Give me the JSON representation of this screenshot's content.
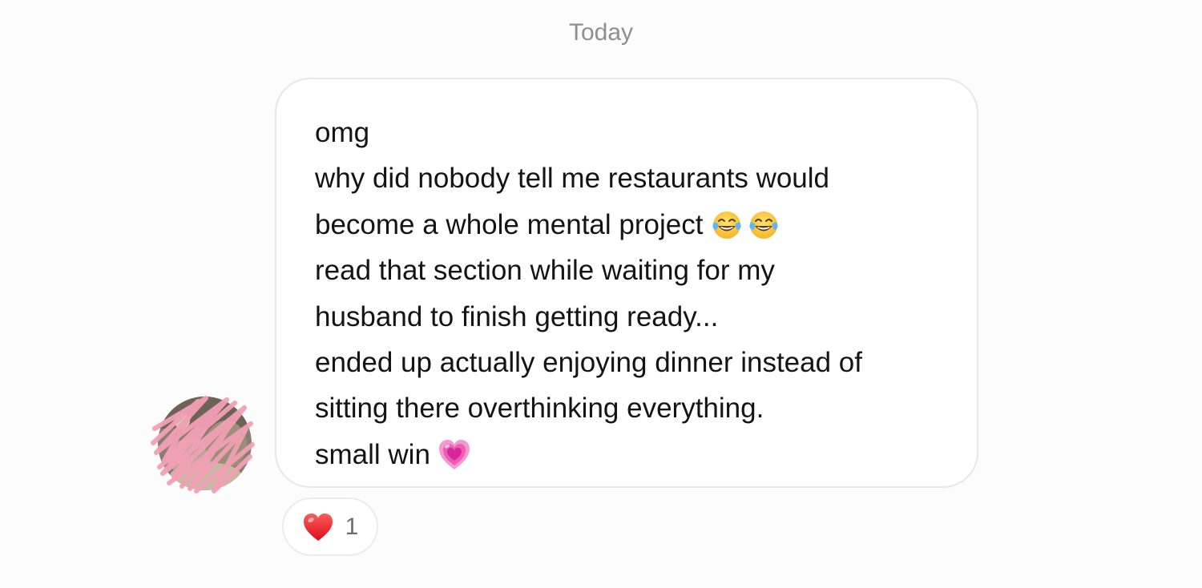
{
  "date_separator": "Today",
  "message": {
    "lines": [
      {
        "text": "omg",
        "emojis": []
      },
      {
        "text": "why did nobody tell me restaurants would",
        "emojis": []
      },
      {
        "text": "become a whole mental project",
        "emojis": [
          "tears-of-joy-emoji",
          "tears-of-joy-emoji"
        ]
      },
      {
        "text": "read that section while waiting for my",
        "emojis": []
      },
      {
        "text": "husband to finish getting ready...",
        "emojis": []
      },
      {
        "text": "ended up actually enjoying dinner instead of",
        "emojis": []
      },
      {
        "text": "sitting there overthinking everything.",
        "emojis": []
      },
      {
        "text": "small win",
        "emojis": [
          "growing-heart-emoji"
        ]
      }
    ]
  },
  "reaction": {
    "emoji": "red-heart-emoji",
    "count": "1"
  },
  "avatar": {
    "icon": "redacted-avatar",
    "scribble_color": "#f2a0b6"
  },
  "colors": {
    "background": "#fcfcfc",
    "bubble_border": "#e7e7e7",
    "date_text": "#8e8e8e",
    "message_text": "#141414"
  }
}
